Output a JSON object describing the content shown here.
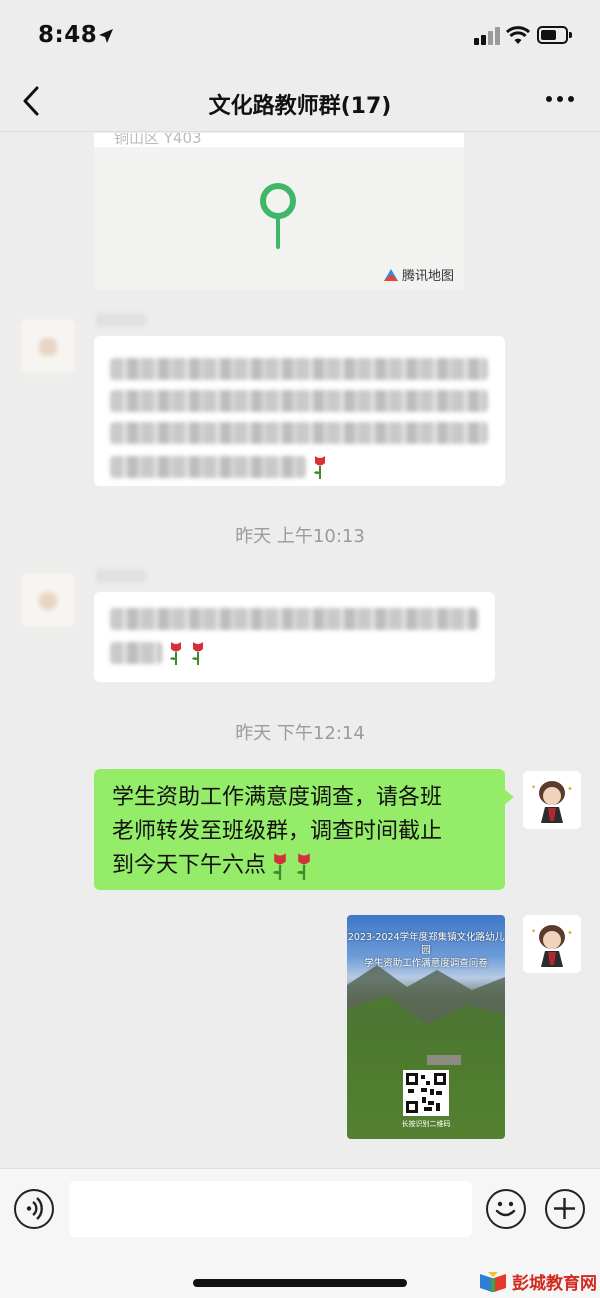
{
  "status_bar": {
    "time": "8:48"
  },
  "header": {
    "title": "文化路教师群(17)"
  },
  "map_card": {
    "address": "铜山区 Y403",
    "map_provider": "腾讯地图"
  },
  "timestamps": [
    "昨天 上午10:13",
    "昨天 下午12:14"
  ],
  "sent_message": {
    "lines": [
      "学生资助工作满意度调查，请各班",
      "老师转发至班级群，调查时间截止",
      "到今天下午六点"
    ],
    "emoji": "rose"
  },
  "poster": {
    "title_line1": "2023-2024学年度郑集镇文化路幼儿园",
    "title_line2": "学生资助工作满意度调查问卷",
    "caption": "长按识别二维码"
  },
  "input_bar": {
    "placeholder": ""
  },
  "watermark": {
    "text": "彭城教育网"
  },
  "colors": {
    "sent_bubble": "#95ec69",
    "background": "#ededed",
    "map_pin": "#3eb866"
  }
}
